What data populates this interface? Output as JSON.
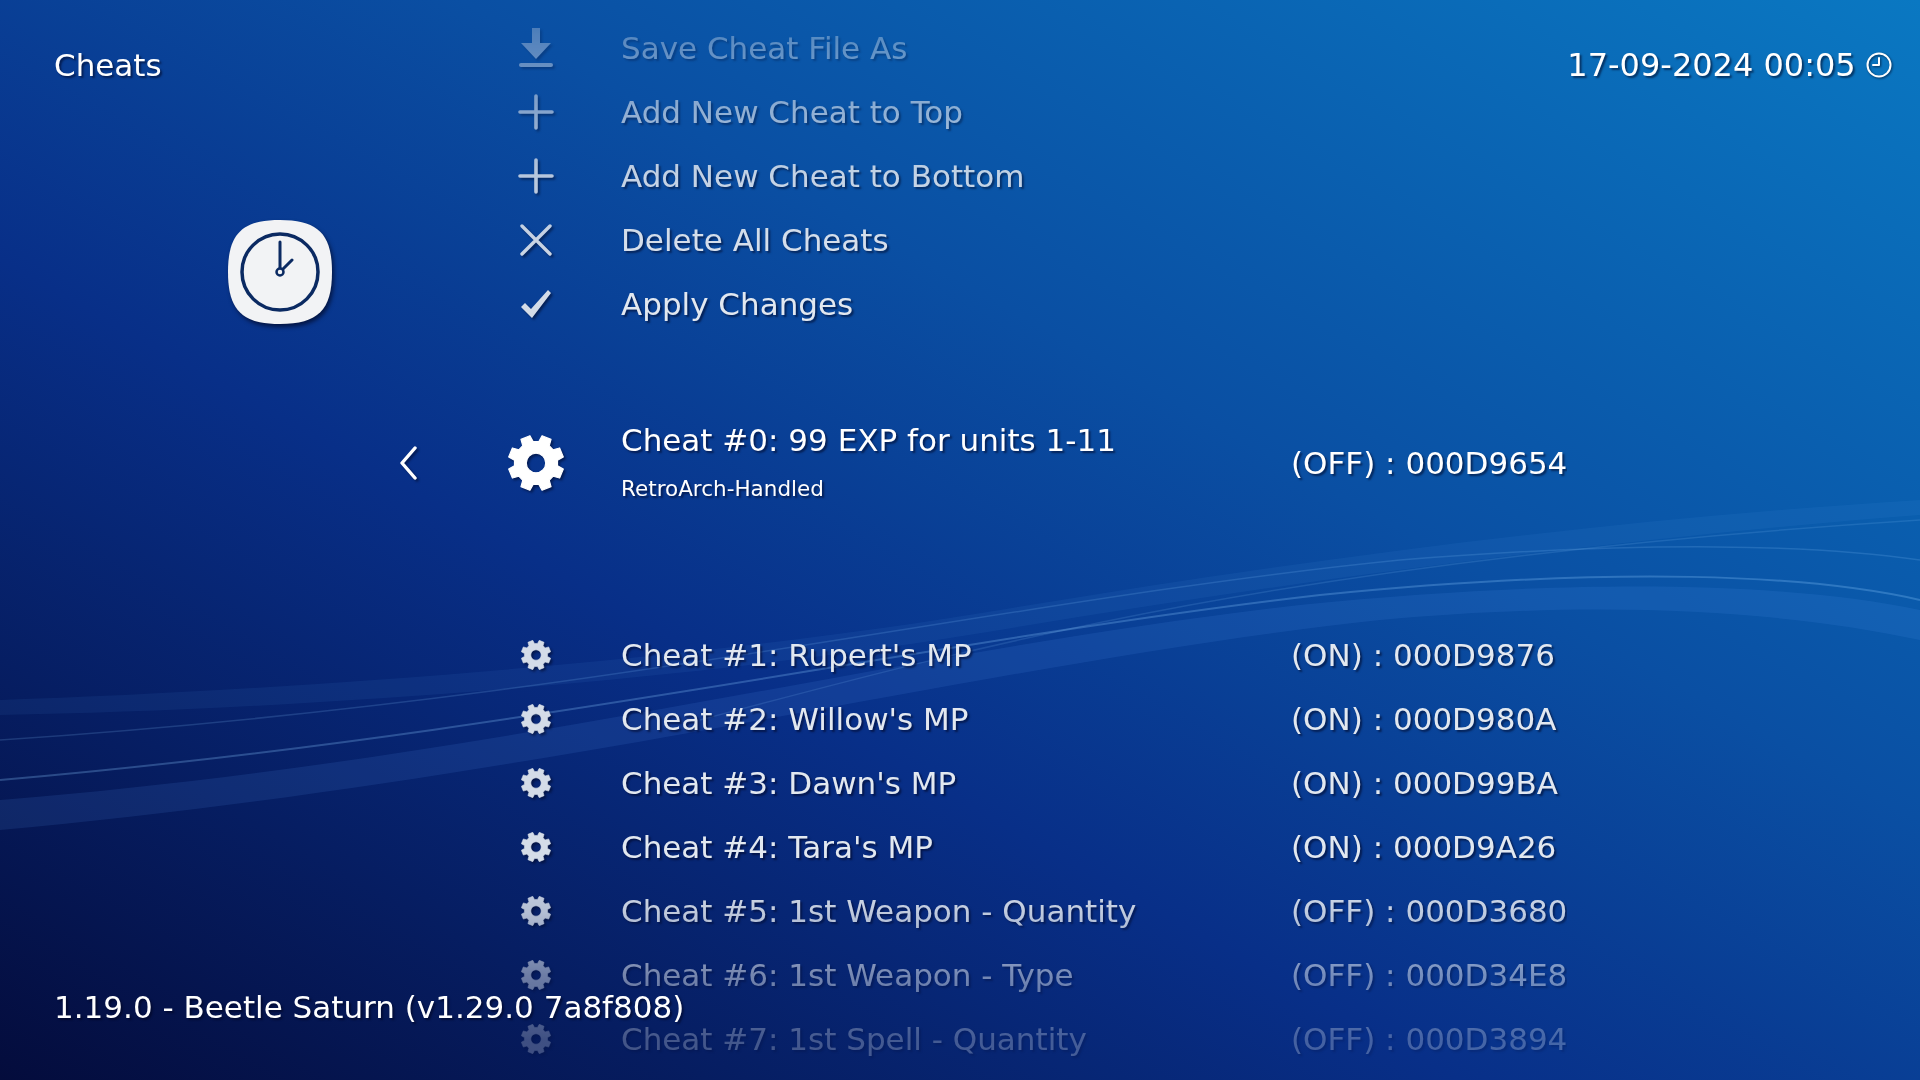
{
  "header": {
    "title": "Cheats",
    "datetime": "17-09-2024 00:05"
  },
  "actions": [
    {
      "kind": "download",
      "label": "Save Cheat File As"
    },
    {
      "kind": "add",
      "label": "Add New Cheat to Top"
    },
    {
      "kind": "add",
      "label": "Add New Cheat to Bottom"
    },
    {
      "kind": "delete",
      "label": "Delete All Cheats"
    },
    {
      "kind": "apply",
      "label": "Apply Changes"
    }
  ],
  "cheats": [
    {
      "label": "Cheat #0: 99 EXP for units 1-11",
      "sublabel": "RetroArch-Handled",
      "value": "(OFF) : 000D9654",
      "selected": true
    },
    {
      "label": "Cheat #1: Rupert's MP",
      "value": "(ON) : 000D9876",
      "selected": false
    },
    {
      "label": "Cheat #2: Willow's MP",
      "value": "(ON) : 000D980A",
      "selected": false
    },
    {
      "label": "Cheat #3: Dawn's MP",
      "value": "(ON) : 000D99BA",
      "selected": false
    },
    {
      "label": "Cheat #4: Tara's MP",
      "value": "(ON) : 000D9A26",
      "selected": false
    },
    {
      "label": "Cheat #5: 1st Weapon - Quantity",
      "value": "(OFF) : 000D3680",
      "selected": false
    },
    {
      "label": "Cheat #6: 1st Weapon - Type",
      "value": "(OFF) : 000D34E8",
      "selected": false
    },
    {
      "label": "Cheat #7: 1st Spell - Quantity",
      "value": "(OFF) : 000D3894",
      "selected": false
    }
  ],
  "footer": "1.19.0 - Beetle Saturn (v1.29.0 7a8f808)"
}
